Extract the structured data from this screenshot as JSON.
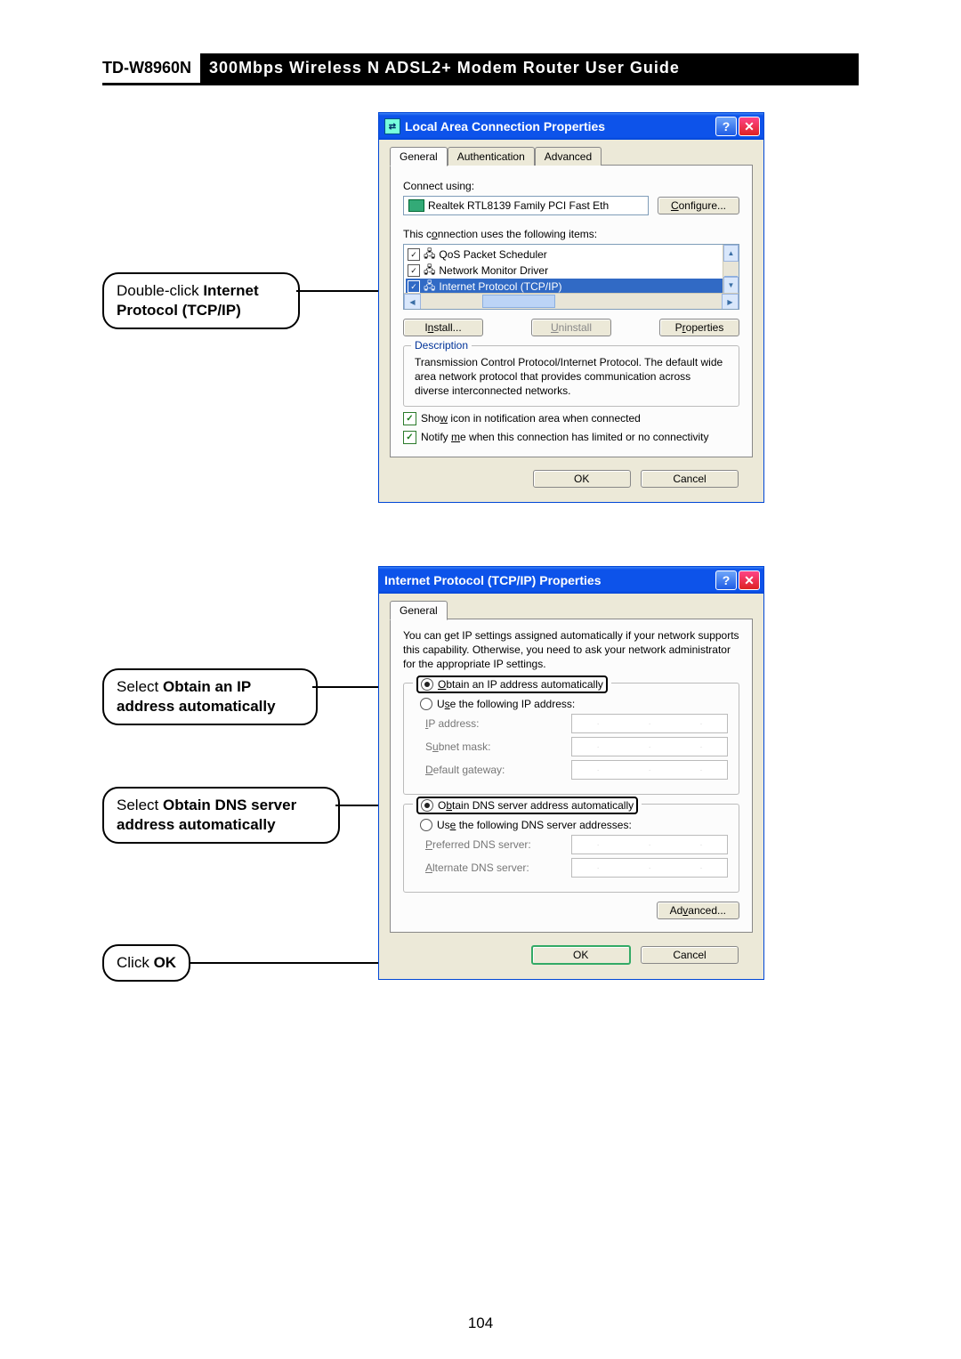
{
  "header": {
    "model": "TD-W8960N",
    "title": "300Mbps  Wireless  N  ADSL2+  Modem  Router  User  Guide"
  },
  "callouts": {
    "c1_a": "Double-click ",
    "c1_b": "Internet Protocol (TCP/IP)",
    "c2_a": "Select ",
    "c2_b": "Obtain an IP address automatically",
    "c3_a": "Select ",
    "c3_b": "Obtain DNS server address automatically",
    "c4_a": "Click ",
    "c4_b": "OK"
  },
  "dialog1": {
    "title": "Local Area Connection Properties",
    "tabs": {
      "t1": "General",
      "t2": "Authentication",
      "t3": "Advanced"
    },
    "connect_using_label": "Connect using:",
    "adapter": "Realtek RTL8139 Family PCI Fast Eth",
    "configure_btn": "Configure...",
    "items_label": "This connection uses the following items:",
    "items": {
      "i1": "QoS Packet Scheduler",
      "i2": "Network Monitor Driver",
      "i3": "Internet Protocol (TCP/IP)"
    },
    "install_btn": "Install...",
    "uninstall_btn": "Uninstall",
    "properties_btn": "Properties",
    "desc_label": "Description",
    "desc_text": "Transmission Control Protocol/Internet Protocol. The default wide area network protocol that provides communication across diverse interconnected networks.",
    "show_icon": "Show icon in notification area when connected",
    "notify": "Notify me when this connection has limited or no connectivity",
    "ok": "OK",
    "cancel": "Cancel"
  },
  "dialog2": {
    "title": "Internet Protocol (TCP/IP) Properties",
    "tab": "General",
    "intro": "You can get IP settings assigned automatically if your network supports this capability. Otherwise, you need to ask your network administrator for the appropriate IP settings.",
    "opt_auto_ip": "Obtain an IP address automatically",
    "opt_use_ip": "Use the following IP address:",
    "ip_label": "IP address:",
    "mask_label": "Subnet mask:",
    "gw_label": "Default gateway:",
    "opt_auto_dns": "Obtain DNS server address automatically",
    "opt_use_dns": "Use the following DNS server addresses:",
    "pref_dns": "Preferred DNS server:",
    "alt_dns": "Alternate DNS server:",
    "advanced": "Advanced...",
    "ok": "OK",
    "cancel": "Cancel"
  },
  "page_number": "104"
}
